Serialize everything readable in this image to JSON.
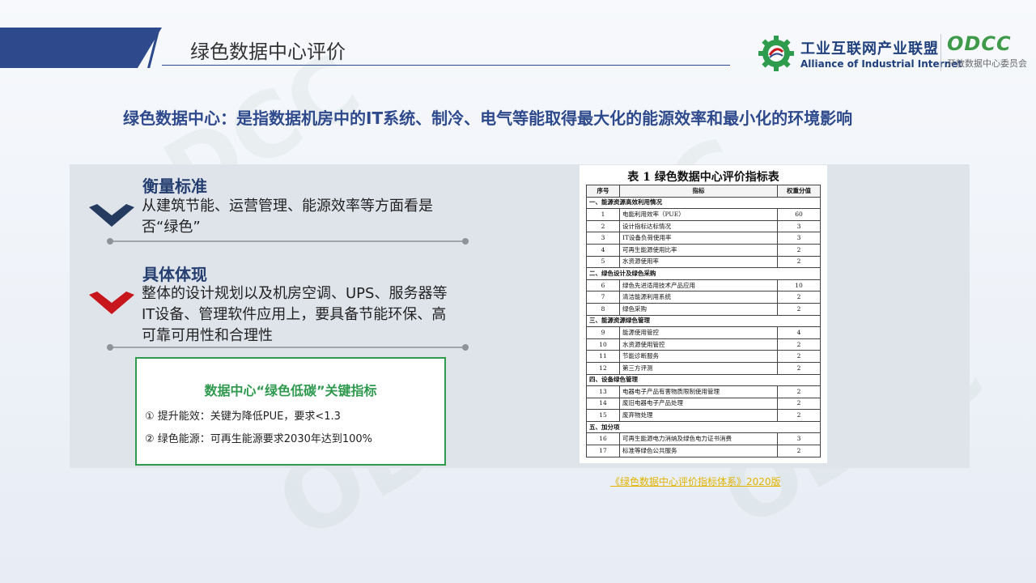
{
  "page": {
    "title": "绿色数据中心评价"
  },
  "watermark": {
    "text": "ODCC",
    "sub": "开放数据中心委员会"
  },
  "logos": {
    "aii": {
      "cn": "工业互联网产业联盟",
      "en": "Alliance of Industrial Internet"
    },
    "odcc": {
      "main": "ODCC",
      "sub": "开放数据中心委员会"
    }
  },
  "headline": "绿色数据中心：是指数据机房中的IT系统、制冷、电气等能取得最大化的能源效率和最小化的环境影响",
  "sections": [
    {
      "title": "衡量标准",
      "body": "从建筑节能、运营管理、能源效率等方面看是否“绿色”"
    },
    {
      "title": "具体体现",
      "body": "整体的设计规划以及机房空调、UPS、服务器等IT设备、管理软件应用上，要具备节能环保、高可靠可用性和合理性"
    }
  ],
  "green_box": {
    "title": "数据中心“绿色低碳”关键指标",
    "items": [
      "①   提升能效：关键为降低PUE，要求<1.3",
      "②   绿色能源：可再生能源要求2030年达到100%"
    ]
  },
  "doc": {
    "title": "表 1  绿色数据中心评价指标表",
    "headers": [
      "序号",
      "指标",
      "权重分值"
    ],
    "rows": [
      {
        "type": "section",
        "label": "一、能源资源高效利用情况"
      },
      {
        "no": "1",
        "name": "电能利用效率（PUE）",
        "score": "60"
      },
      {
        "no": "2",
        "name": "设计指标达标情况",
        "score": "3"
      },
      {
        "no": "3",
        "name": "IT设备负荷使用率",
        "score": "3"
      },
      {
        "no": "4",
        "name": "可再生能源使用比率",
        "score": "2"
      },
      {
        "no": "5",
        "name": "水资源使用率",
        "score": "2"
      },
      {
        "type": "section",
        "label": "二、绿色设计及绿色采购"
      },
      {
        "no": "6",
        "name": "绿色先进适用技术产品应用",
        "score": "10"
      },
      {
        "no": "7",
        "name": "清洁能源利用系统",
        "score": "2"
      },
      {
        "no": "8",
        "name": "绿色采购",
        "score": "2"
      },
      {
        "type": "section",
        "label": "三、能源资源绿色管理"
      },
      {
        "no": "9",
        "name": "能源使用管控",
        "score": "4"
      },
      {
        "no": "10",
        "name": "水资源使用管控",
        "score": "2"
      },
      {
        "no": "11",
        "name": "节能诊断服务",
        "score": "2"
      },
      {
        "no": "12",
        "name": "第三方评测",
        "score": "2"
      },
      {
        "type": "section",
        "label": "四、设备绿色管理"
      },
      {
        "no": "13",
        "name": "电器电子产品有害物质限制使用管理",
        "score": "2"
      },
      {
        "no": "14",
        "name": "废旧电器电子产品处理",
        "score": "2"
      },
      {
        "no": "15",
        "name": "废弃物处理",
        "score": "2"
      },
      {
        "type": "section",
        "label": "五、加分项"
      },
      {
        "no": "16",
        "name": "可再生能源电力消纳及绿色电力证书消费",
        "score": "3"
      },
      {
        "no": "17",
        "name": "标准等绿色公共服务",
        "score": "2"
      }
    ]
  },
  "caption": "《绿色数据中心评价指标体系》2020版",
  "colors": {
    "primary": "#2f4a8c",
    "accent_red": "#c8171c",
    "dark_chevron": "#243a5e",
    "green": "#2e9b4d",
    "caption": "#e0b400"
  }
}
